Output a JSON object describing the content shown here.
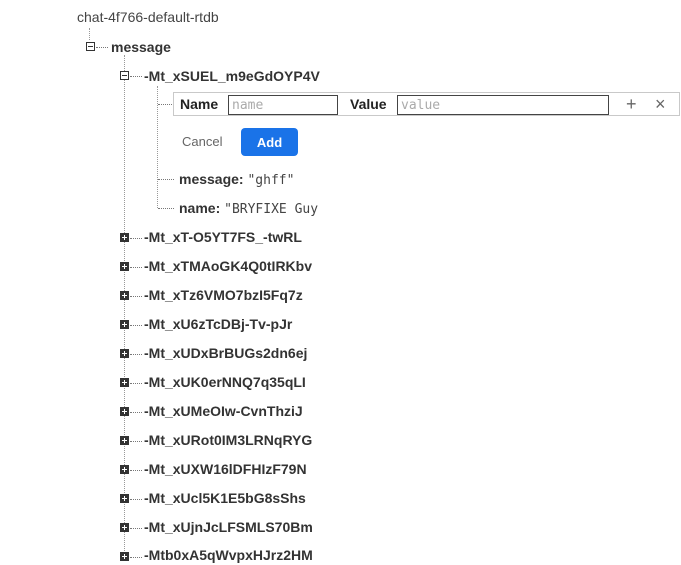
{
  "root": {
    "label": "chat-4f766-default-rtdb"
  },
  "message_node": {
    "label": "message"
  },
  "expanded_child": {
    "key": "-Mt_xSUEL_m9eGdOYP4V",
    "editor": {
      "name_label": "Name",
      "name_placeholder": "name",
      "value_label": "Value",
      "value_placeholder": "value",
      "add_icon": "+",
      "close_icon": "×"
    },
    "cancel_label": "Cancel",
    "add_label": "Add",
    "fields": [
      {
        "key": "message:",
        "value": "\"ghff\""
      },
      {
        "key": "name:",
        "value": "\"BRYFIXE Guy"
      }
    ]
  },
  "collapsed_children": [
    "-Mt_xT-O5YT7FS_-twRL",
    "-Mt_xTMAoGK4Q0tIRKbv",
    "-Mt_xTz6VMO7bzI5Fq7z",
    "-Mt_xU6zTcDBj-Tv-pJr",
    "-Mt_xUDxBrBUGs2dn6ej",
    "-Mt_xUK0erNNQ7q35qLI",
    "-Mt_xUMeOIw-CvnThziJ",
    "-Mt_xURot0IM3LRNqRYG",
    "-Mt_xUXW16lDFHIzF79N",
    "-Mt_xUcl5K1E5bG8sShs",
    "-Mt_xUjnJcLFSMLS70Bm",
    "-Mtb0xA5qWvpxHJrz2HM"
  ]
}
